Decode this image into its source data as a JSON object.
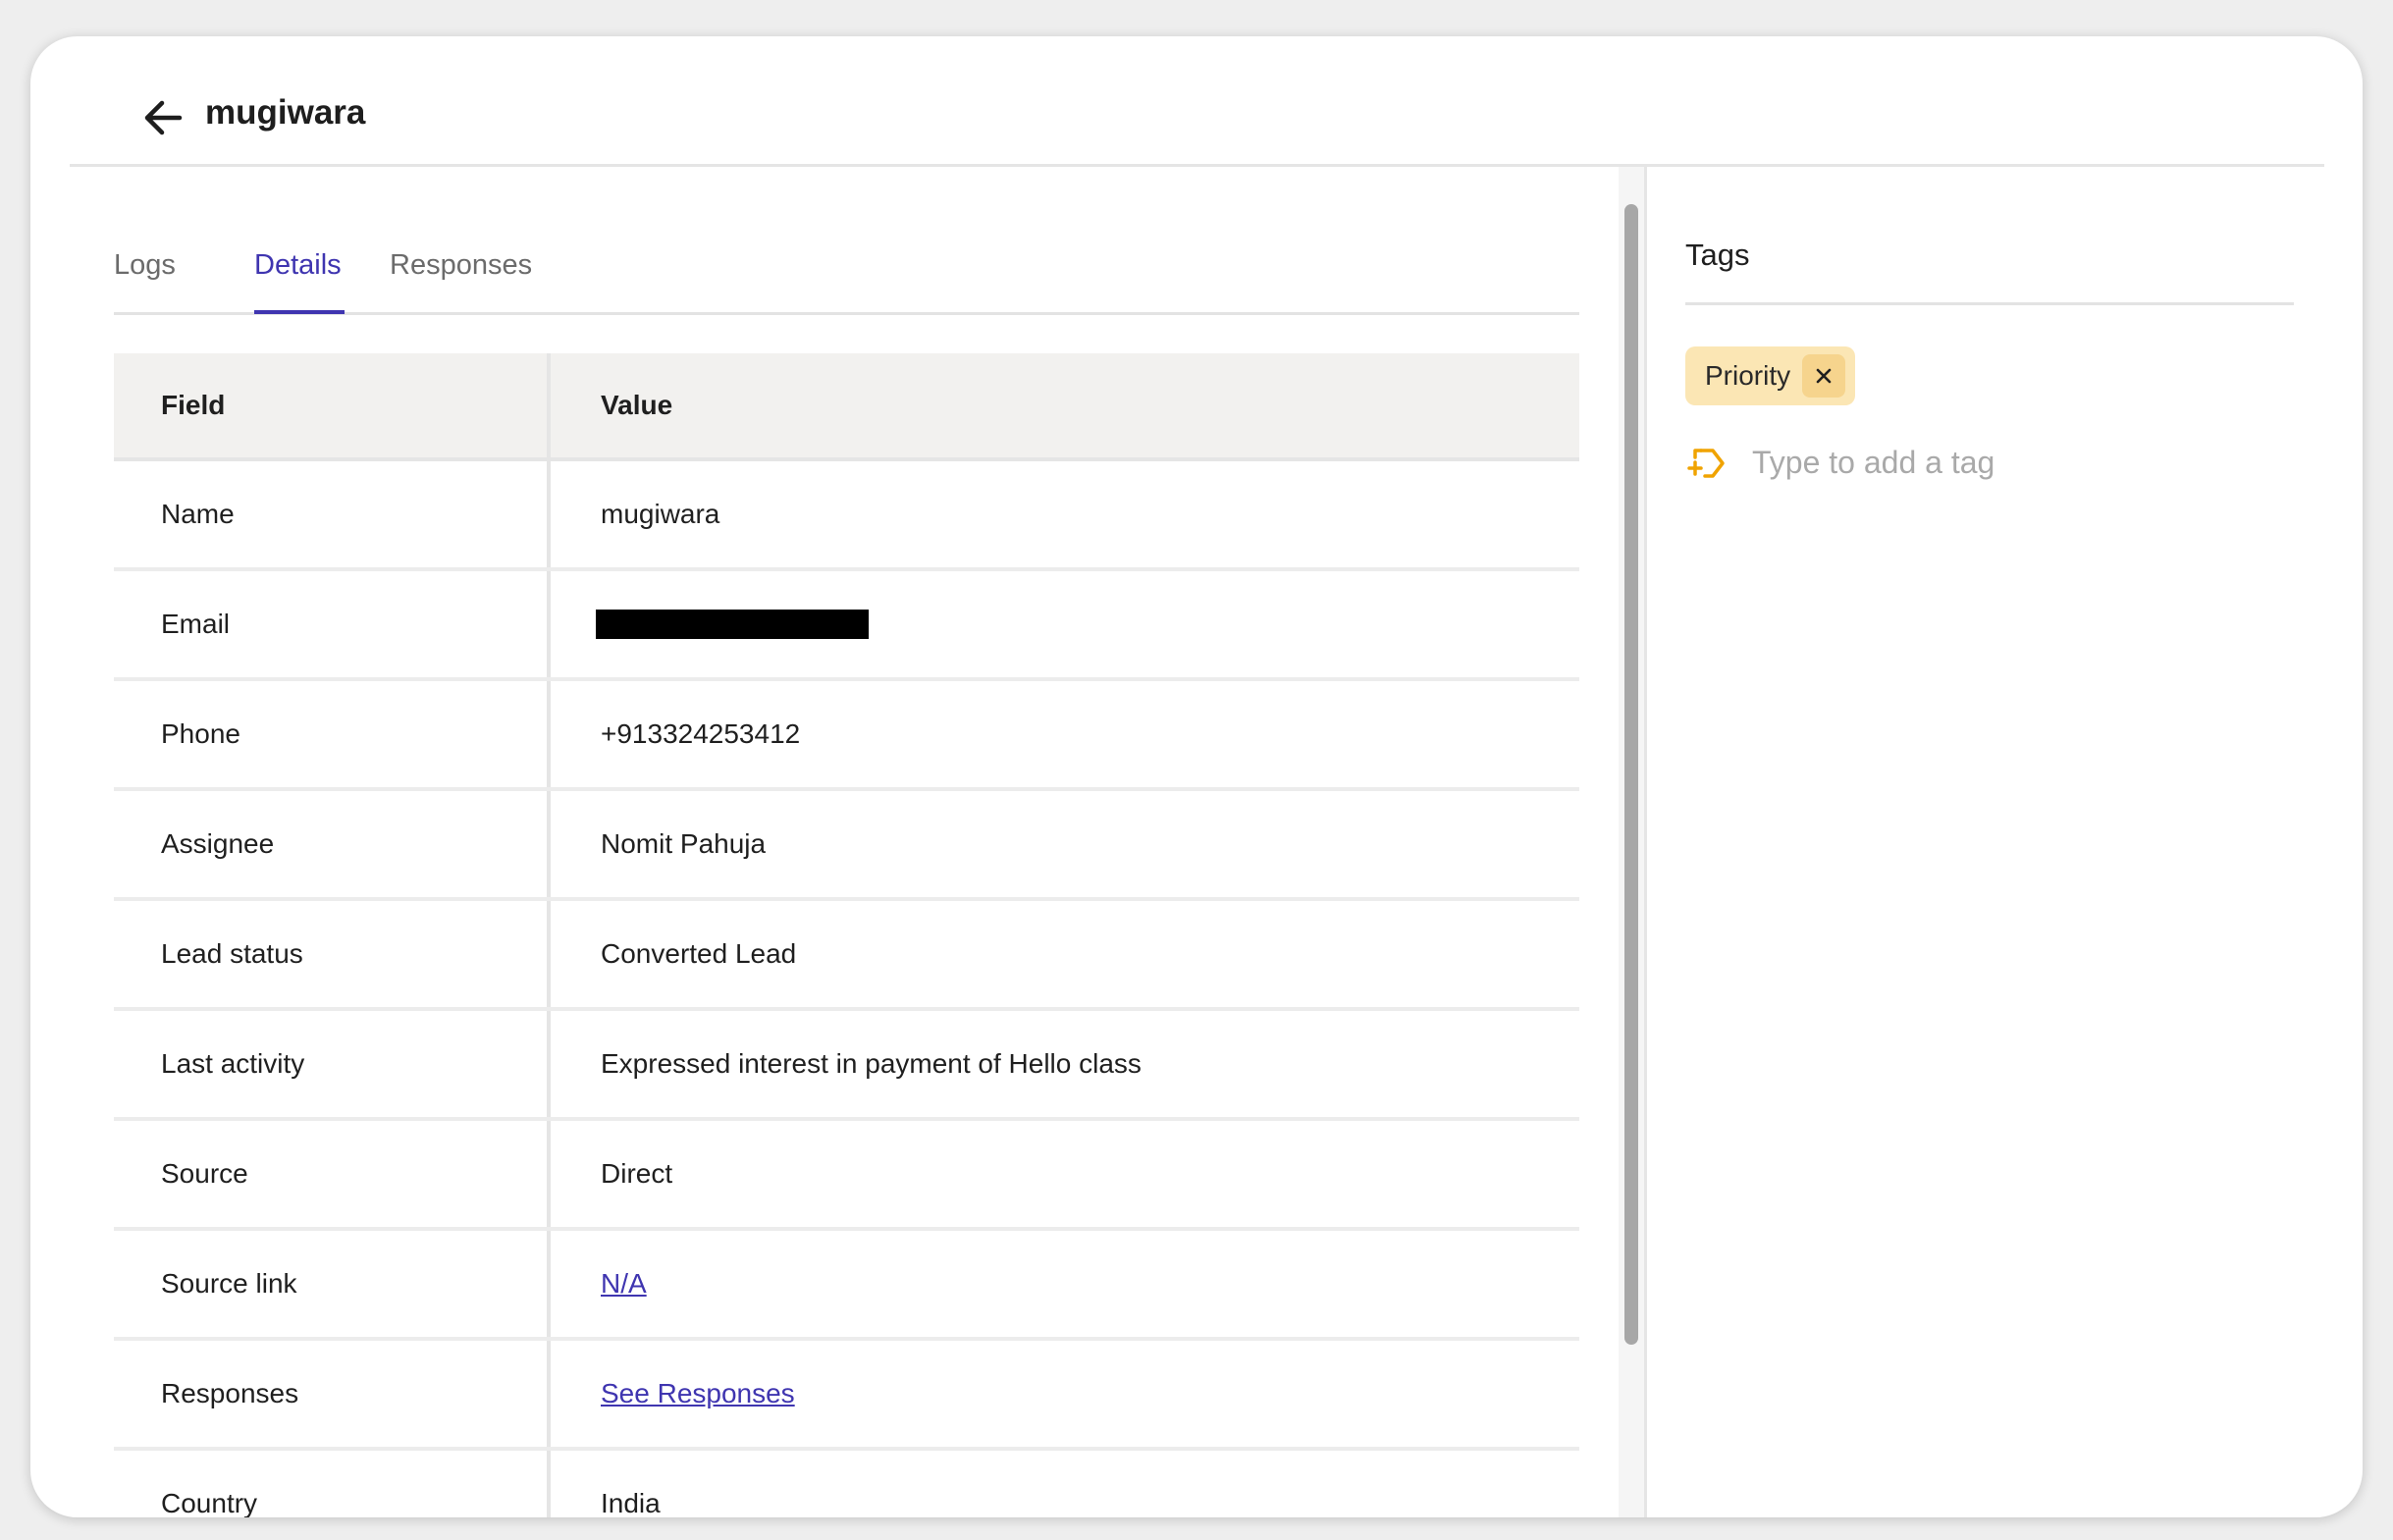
{
  "header": {
    "title": "mugiwara"
  },
  "tabs": [
    {
      "label": "Logs"
    },
    {
      "label": "Details"
    },
    {
      "label": "Responses"
    }
  ],
  "table": {
    "headers": {
      "field": "Field",
      "value": "Value"
    },
    "rows": [
      {
        "field": "Name",
        "value": "mugiwara"
      },
      {
        "field": "Email",
        "value": ""
      },
      {
        "field": "Phone",
        "value": "+913324253412"
      },
      {
        "field": "Assignee",
        "value": "Nomit Pahuja"
      },
      {
        "field": "Lead status",
        "value": "Converted Lead"
      },
      {
        "field": "Last activity",
        "value": "Expressed interest in payment of Hello class"
      },
      {
        "field": "Source",
        "value": "Direct"
      },
      {
        "field": "Source link",
        "value": "N/A"
      },
      {
        "field": "Responses",
        "value": "See Responses"
      },
      {
        "field": "Country",
        "value": "India"
      }
    ]
  },
  "tags_panel": {
    "title": "Tags",
    "tags": [
      {
        "label": "Priority"
      }
    ],
    "input_placeholder": "Type to add a tag"
  },
  "colors": {
    "accent": "#3f35b0",
    "tag_bg": "#fbe6b4",
    "tag_icon": "#f0a300"
  },
  "icons": {
    "back": "arrow-left-icon",
    "remove_tag": "close-icon",
    "add_tag": "tag-add-icon"
  }
}
